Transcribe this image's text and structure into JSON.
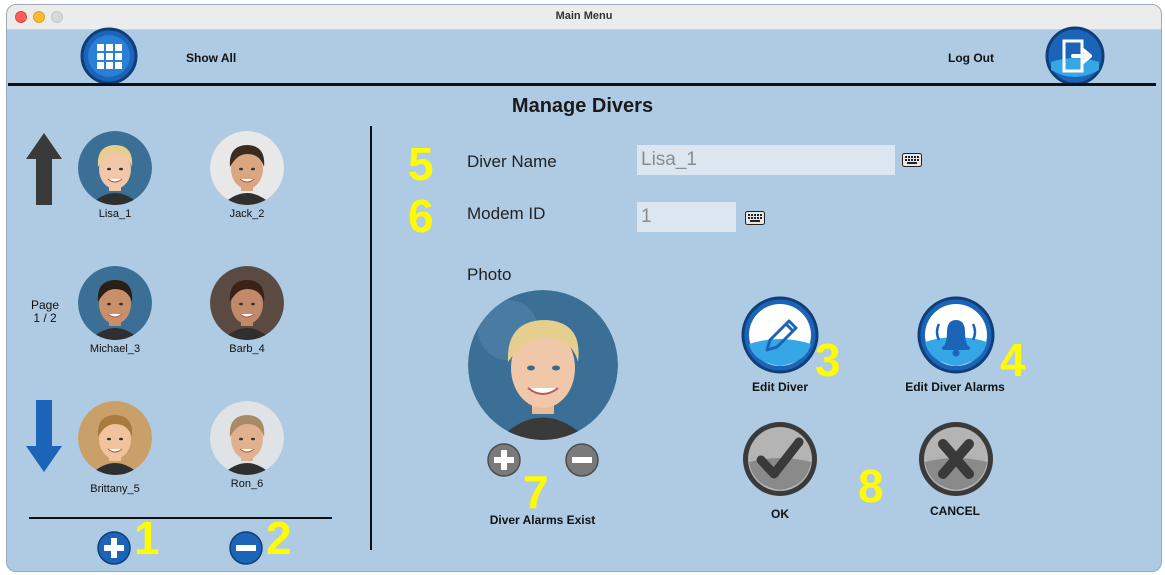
{
  "window": {
    "title": "Main Menu"
  },
  "toolbar": {
    "show_all_label": "Show All",
    "log_out_label": "Log Out",
    "grid_icon": "grid-icon",
    "logout_icon": "logout-door-icon"
  },
  "page_title": "Manage Divers",
  "divers": [
    {
      "name": "Lisa_1",
      "hair": "#e6cf8e",
      "skin": "#f0c7a8",
      "bg": "#3b6f96"
    },
    {
      "name": "Jack_2",
      "hair": "#3a2a1f",
      "skin": "#d9a67f",
      "bg": "#e8e8e8"
    },
    {
      "name": "Michael_3",
      "hair": "#2a1f17",
      "skin": "#c98f68",
      "bg": "#3b6f96"
    },
    {
      "name": "Barb_4",
      "hair": "#3a2216",
      "skin": "#c28a6a",
      "bg": "#5a4a42"
    },
    {
      "name": "Brittany_5",
      "hair": "#a87a3e",
      "skin": "#f0c39c",
      "bg": "#c9a06a"
    },
    {
      "name": "Ron_6",
      "hair": "#a88a66",
      "skin": "#e1b08e",
      "bg": "#dfe3e6"
    }
  ],
  "pager": {
    "line1": "Page",
    "line2": "1 / 2"
  },
  "form": {
    "diver_name_label": "Diver Name",
    "diver_name_value": "Lisa_1",
    "modem_id_label": "Modem ID",
    "modem_id_value": "1",
    "photo_label": "Photo",
    "alarms_status": "Diver Alarms Exist"
  },
  "actions": {
    "edit_diver_label": "Edit Diver",
    "edit_alarms_label": "Edit Diver Alarms",
    "ok_label": "OK",
    "cancel_label": "CANCEL"
  },
  "callouts": {
    "c1": "1",
    "c2": "2",
    "c3": "3",
    "c4": "4",
    "c5": "5",
    "c6": "6",
    "c7": "7",
    "c8": "8"
  },
  "colors": {
    "background": "#aecbe3",
    "accent_blue": "#1c64b8",
    "callout": "#fffb00",
    "gray_button": "#7a7a7a"
  }
}
